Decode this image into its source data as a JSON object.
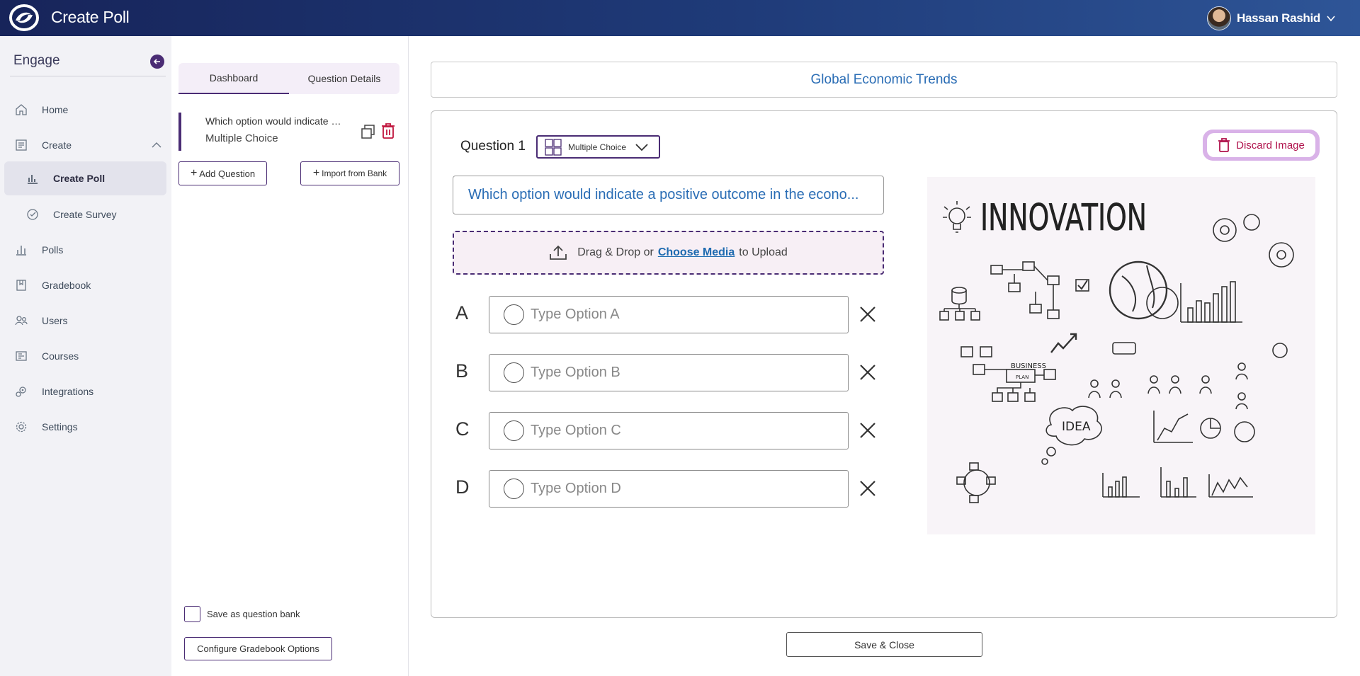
{
  "header": {
    "app_title": "Create Poll",
    "user_name": "Hassan Rashid"
  },
  "sidebar": {
    "title": "Engage",
    "items": [
      {
        "label": "Home",
        "icon": "home-icon"
      },
      {
        "label": "Create",
        "icon": "create-icon",
        "expanded": true
      },
      {
        "label": "Create Poll",
        "icon": "poll-icon",
        "active": true
      },
      {
        "label": "Create Survey",
        "icon": "survey-icon"
      },
      {
        "label": "Polls",
        "icon": "bar-chart-icon"
      },
      {
        "label": "Gradebook",
        "icon": "book-icon"
      },
      {
        "label": "Users",
        "icon": "users-icon"
      },
      {
        "label": "Courses",
        "icon": "courses-icon"
      },
      {
        "label": "Integrations",
        "icon": "integrations-icon"
      },
      {
        "label": "Settings",
        "icon": "gear-icon"
      }
    ]
  },
  "panel": {
    "tabs": [
      {
        "label": "Dashboard",
        "active": true
      },
      {
        "label": "Question Details"
      }
    ],
    "question_item": {
      "text": "Which option would indicate a positive outcome in the econo...",
      "type": "Multiple Choice"
    },
    "add_question": "Add Question",
    "import_from_bank": "Import from Bank",
    "save_as_bank": "Save as question bank",
    "configure_gradebook": "Configure Gradebook Options"
  },
  "main": {
    "poll_title": "Global Economic Trends",
    "question_label": "Question 1",
    "question_type": "Multiple Choice",
    "discard_image": "Discard Image",
    "question_text": "Which option would indicate a positive outcome in the econo...",
    "upload": {
      "prefix": "Drag & Drop or",
      "link": "Choose Media",
      "suffix": "to Upload"
    },
    "options": [
      {
        "letter": "A",
        "placeholder": "Type Option A"
      },
      {
        "letter": "B",
        "placeholder": "Type Option B"
      },
      {
        "letter": "C",
        "placeholder": "Type Option C"
      },
      {
        "letter": "D",
        "placeholder": "Type Option D"
      }
    ],
    "image": {
      "heading": "INNOVATION",
      "business_label": "BUSINESS",
      "plan_label": "PLAN",
      "idea_label": "IDEA"
    },
    "save_close": "Save & Close"
  },
  "colors": {
    "accent": "#4a2c74",
    "link": "#2a6db5",
    "danger": "#b0124c"
  }
}
